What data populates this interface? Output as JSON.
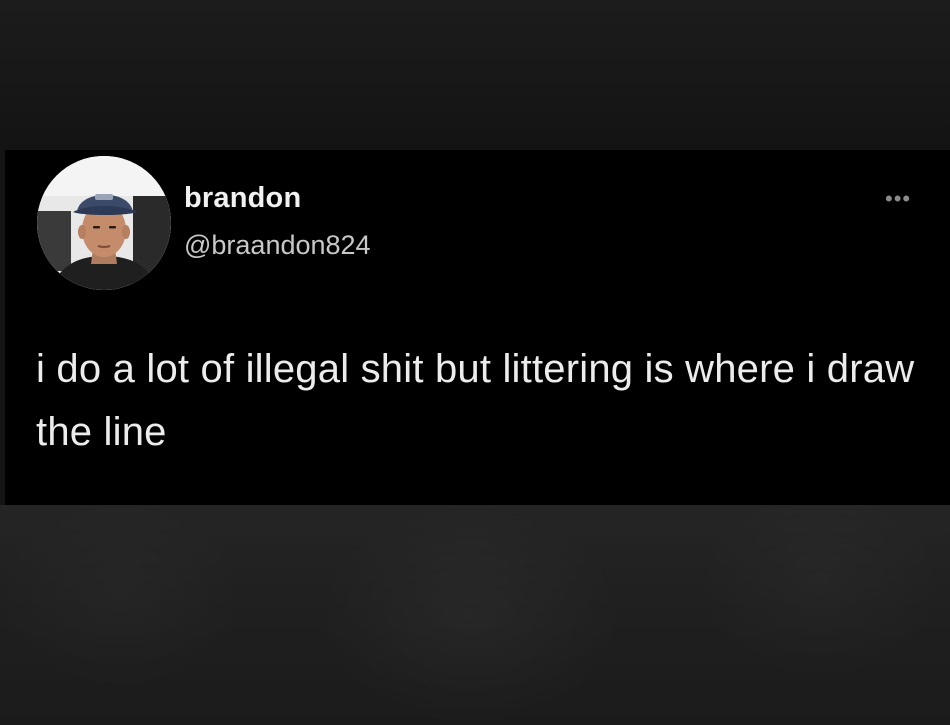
{
  "tweet": {
    "display_name": "brandon",
    "handle": "@braandon824",
    "more_options": "•••",
    "text": "i do a lot of illegal shit but littering is where i draw the line"
  },
  "colors": {
    "page_background": "#141414",
    "card_background": "#000000",
    "name_text": "#f1f1f1",
    "handle_text": "#c8c8c8",
    "body_text": "#ececec",
    "icon_gray": "#8a8a8a"
  },
  "icons": {
    "more": "more-options-icon",
    "avatar": "profile-photo"
  }
}
